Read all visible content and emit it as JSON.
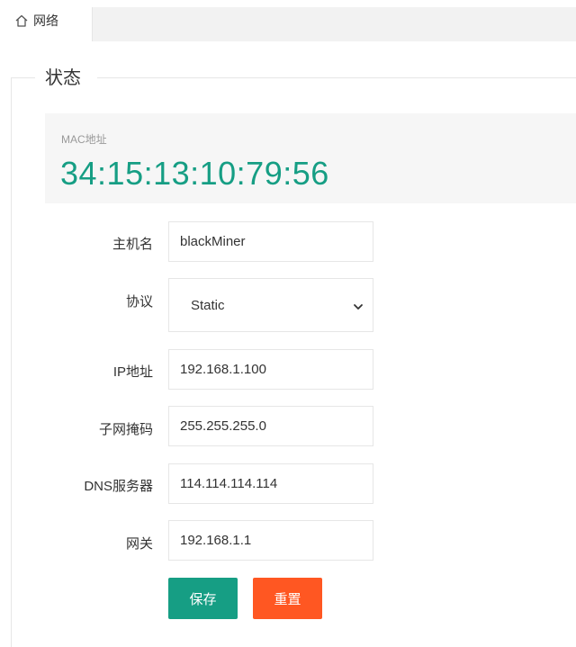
{
  "tab": {
    "label": "网络",
    "icon": "home-icon"
  },
  "section": {
    "legend": "状态"
  },
  "mac": {
    "label": "MAC地址",
    "value": "34:15:13:10:79:56",
    "color": "#169e84"
  },
  "form": {
    "hostname": {
      "label": "主机名",
      "value": "blackMiner"
    },
    "protocol": {
      "label": "协议",
      "value": "Static"
    },
    "ip": {
      "label": "IP地址",
      "value": "192.168.1.100"
    },
    "netmask": {
      "label": "子网掩码",
      "value": "255.255.255.0"
    },
    "dns": {
      "label": "DNS服务器",
      "value": "114.114.114.114"
    },
    "gateway": {
      "label": "网关",
      "value": "192.168.1.1"
    }
  },
  "buttons": {
    "save": {
      "label": "保存",
      "color": "#169e84"
    },
    "reset": {
      "label": "重置",
      "color": "#ff5722"
    }
  }
}
